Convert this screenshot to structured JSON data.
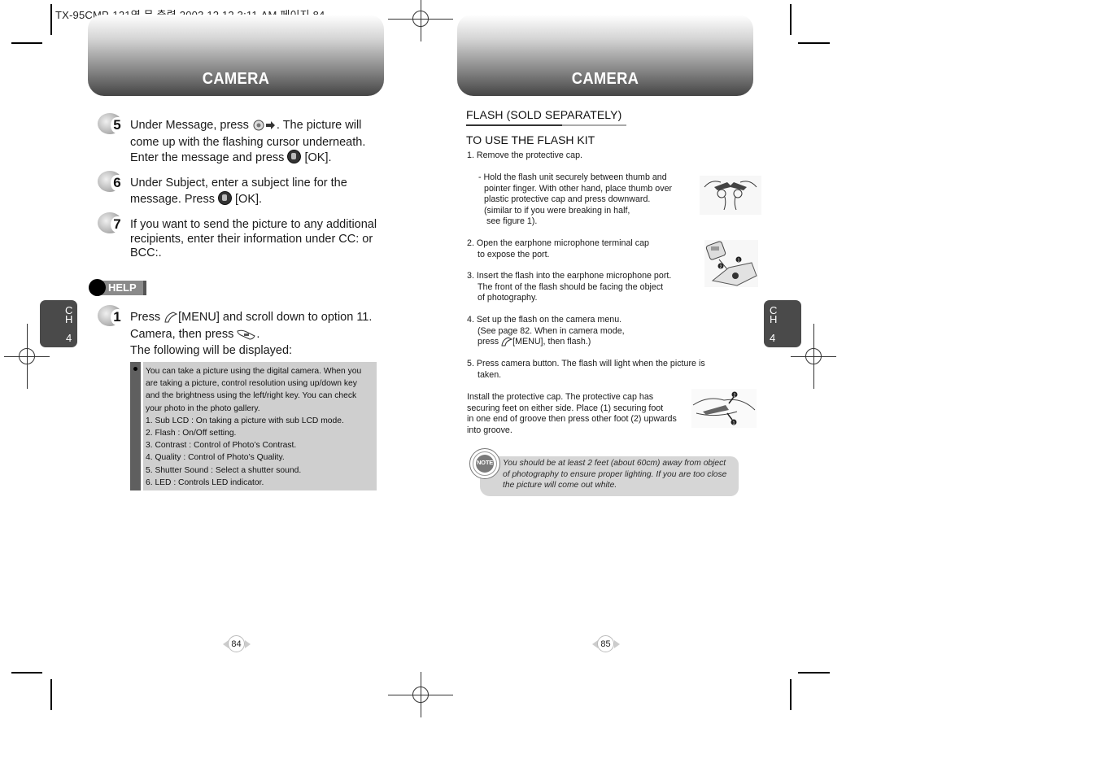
{
  "print_header": "TX-95CMP-121영 문 출력  2003.12.12 3:11 AM 페이지 84",
  "left_page": {
    "banner_title": "CAMERA",
    "chapter_tab": {
      "c": "C",
      "h": "H",
      "num": "4"
    },
    "steps": [
      {
        "number": "5",
        "lines": [
          "Under Message, press",
          ". The picture will",
          "come up with the flashing cursor underneath.",
          "Enter the message and press",
          "[OK]."
        ]
      },
      {
        "number": "6",
        "lines": [
          "Under Subject, enter a subject line for the",
          "message. Press",
          "[OK]."
        ]
      },
      {
        "number": "7",
        "lines": [
          "If you want to send the picture to any additional",
          "recipients, enter their information under CC: or",
          "BCC:."
        ]
      }
    ],
    "help_label": "HELP",
    "help_step": {
      "number": "1",
      "lines": [
        "Press",
        "[MENU] and scroll down to option 11.",
        "Camera, then press",
        ".",
        "The following will be displayed:"
      ]
    },
    "info_box": [
      "You can take a picture using the digital camera.  When you",
      "are taking a picture, control resolution using up/down key",
      "and the brightness using the left/right key.  You can check",
      "your photo in the photo gallery.",
      "1. Sub LCD : On taking a picture with sub LCD mode.",
      "2. Flash : On/Off setting.",
      "3. Contrast : Control of Photo’s Contrast.",
      "4. Quality : Control of Photo’s Quality.",
      "5. Shutter Sound : Select a shutter sound.",
      "6. LED : Controls LED indicator."
    ],
    "page_number": "84"
  },
  "right_page": {
    "banner_title": "CAMERA",
    "chapter_tab": {
      "c": "C",
      "h": "H",
      "num": "4"
    },
    "section_title": "FLASH (SOLD SEPARATELY)",
    "subsection_title": "TO USE THE FLASH KIT",
    "step1": [
      "1. Remove the protective cap."
    ],
    "step1_detail": [
      "- Hold the flash unit securely between thumb and",
      "  pointer finger. With other hand, place thumb over",
      "  plastic protective cap and press downward.",
      "  (similar to if you were breaking in half,",
      "   see figure 1)."
    ],
    "step2": [
      "2. Open the earphone microphone terminal cap",
      "    to expose the port."
    ],
    "step3": [
      "3. Insert the flash into the earphone microphone port.",
      "    The front of the flash should be facing the object",
      "    of photography."
    ],
    "step4": [
      "4. Set up the flash on the camera menu.",
      "    (See page 82.  When in camera mode,",
      "    press",
      "[MENU], then flash.)"
    ],
    "step5": [
      "5. Press camera button.  The flash will light when the picture is",
      "    taken."
    ],
    "install": [
      "Install the protective cap. The protective cap has",
      "securing feet on either side. Place (1) securing foot",
      "in one end of groove then press other foot (2) upwards",
      "into groove."
    ],
    "note_label": "NOTE",
    "note": [
      "You should be at least 2 feet (about 60cm) away from object",
      "of photography to ensure proper lighting. If you are too close",
      "the picture will come out white."
    ],
    "figure_callouts": {
      "one": "1",
      "two": "2"
    },
    "page_number": "85"
  }
}
